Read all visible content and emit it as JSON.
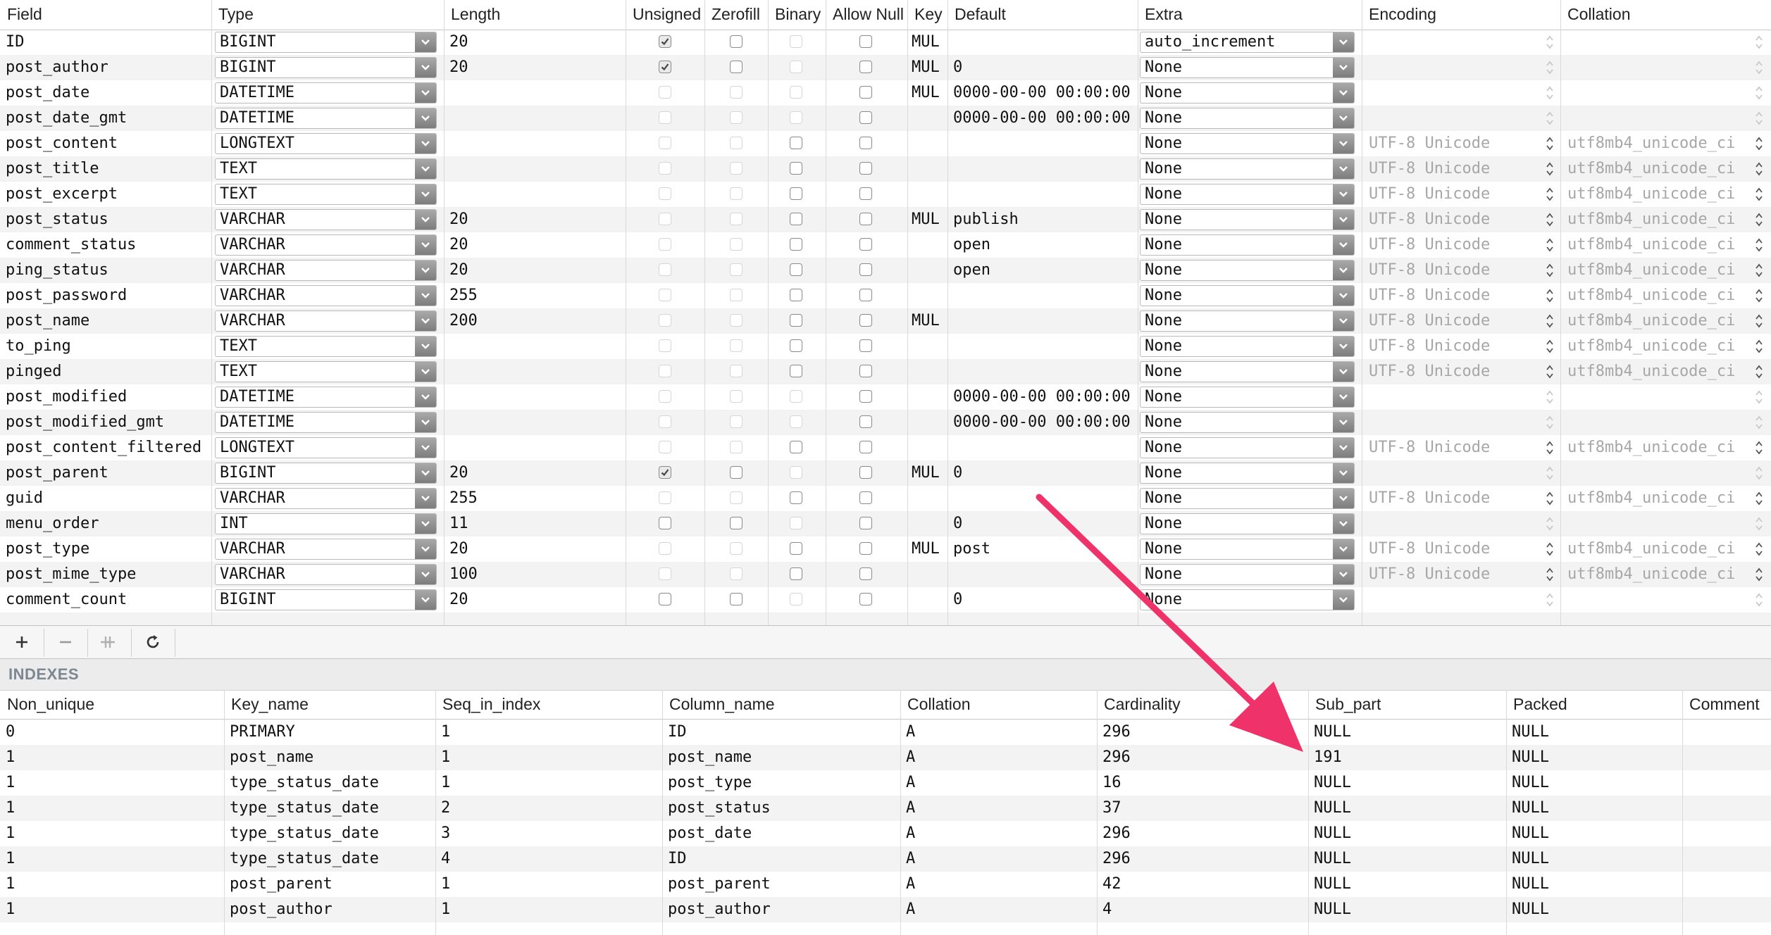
{
  "fields_table": {
    "columns": [
      "Field",
      "Type",
      "Length",
      "Unsigned",
      "Zerofill",
      "Binary",
      "Allow Null",
      "Key",
      "Default",
      "Extra",
      "Encoding",
      "Collation"
    ],
    "rows": [
      {
        "field": "ID",
        "type": "BIGINT",
        "length": "20",
        "unsigned": true,
        "zerofill": false,
        "binary": false,
        "allow_null": false,
        "key": "MUL",
        "default": "",
        "extra": "auto_increment",
        "encoding": "",
        "collation": ""
      },
      {
        "field": "post_author",
        "type": "BIGINT",
        "length": "20",
        "unsigned": true,
        "zerofill": false,
        "binary": false,
        "allow_null": false,
        "key": "MUL",
        "default": "0",
        "extra": "None",
        "encoding": "",
        "collation": ""
      },
      {
        "field": "post_date",
        "type": "DATETIME",
        "length": "",
        "unsigned": false,
        "zerofill": false,
        "binary": false,
        "allow_null": false,
        "key": "MUL",
        "default": "0000-00-00 00:00:00",
        "extra": "None",
        "encoding": "",
        "collation": ""
      },
      {
        "field": "post_date_gmt",
        "type": "DATETIME",
        "length": "",
        "unsigned": false,
        "zerofill": false,
        "binary": false,
        "allow_null": false,
        "key": "",
        "default": "0000-00-00 00:00:00",
        "extra": "None",
        "encoding": "",
        "collation": ""
      },
      {
        "field": "post_content",
        "type": "LONGTEXT",
        "length": "",
        "unsigned": false,
        "zerofill": false,
        "binary": false,
        "allow_null": false,
        "key": "",
        "default": "",
        "extra": "None",
        "encoding": "UTF-8 Unicode",
        "collation": "utf8mb4_unicode_ci"
      },
      {
        "field": "post_title",
        "type": "TEXT",
        "length": "",
        "unsigned": false,
        "zerofill": false,
        "binary": false,
        "allow_null": false,
        "key": "",
        "default": "",
        "extra": "None",
        "encoding": "UTF-8 Unicode",
        "collation": "utf8mb4_unicode_ci"
      },
      {
        "field": "post_excerpt",
        "type": "TEXT",
        "length": "",
        "unsigned": false,
        "zerofill": false,
        "binary": false,
        "allow_null": false,
        "key": "",
        "default": "",
        "extra": "None",
        "encoding": "UTF-8 Unicode",
        "collation": "utf8mb4_unicode_ci"
      },
      {
        "field": "post_status",
        "type": "VARCHAR",
        "length": "20",
        "unsigned": false,
        "zerofill": false,
        "binary": false,
        "allow_null": false,
        "key": "MUL",
        "default": "publish",
        "extra": "None",
        "encoding": "UTF-8 Unicode",
        "collation": "utf8mb4_unicode_ci"
      },
      {
        "field": "comment_status",
        "type": "VARCHAR",
        "length": "20",
        "unsigned": false,
        "zerofill": false,
        "binary": false,
        "allow_null": false,
        "key": "",
        "default": "open",
        "extra": "None",
        "encoding": "UTF-8 Unicode",
        "collation": "utf8mb4_unicode_ci"
      },
      {
        "field": "ping_status",
        "type": "VARCHAR",
        "length": "20",
        "unsigned": false,
        "zerofill": false,
        "binary": false,
        "allow_null": false,
        "key": "",
        "default": "open",
        "extra": "None",
        "encoding": "UTF-8 Unicode",
        "collation": "utf8mb4_unicode_ci"
      },
      {
        "field": "post_password",
        "type": "VARCHAR",
        "length": "255",
        "unsigned": false,
        "zerofill": false,
        "binary": false,
        "allow_null": false,
        "key": "",
        "default": "",
        "extra": "None",
        "encoding": "UTF-8 Unicode",
        "collation": "utf8mb4_unicode_ci"
      },
      {
        "field": "post_name",
        "type": "VARCHAR",
        "length": "200",
        "unsigned": false,
        "zerofill": false,
        "binary": false,
        "allow_null": false,
        "key": "MUL",
        "default": "",
        "extra": "None",
        "encoding": "UTF-8 Unicode",
        "collation": "utf8mb4_unicode_ci"
      },
      {
        "field": "to_ping",
        "type": "TEXT",
        "length": "",
        "unsigned": false,
        "zerofill": false,
        "binary": false,
        "allow_null": false,
        "key": "",
        "default": "",
        "extra": "None",
        "encoding": "UTF-8 Unicode",
        "collation": "utf8mb4_unicode_ci"
      },
      {
        "field": "pinged",
        "type": "TEXT",
        "length": "",
        "unsigned": false,
        "zerofill": false,
        "binary": false,
        "allow_null": false,
        "key": "",
        "default": "",
        "extra": "None",
        "encoding": "UTF-8 Unicode",
        "collation": "utf8mb4_unicode_ci"
      },
      {
        "field": "post_modified",
        "type": "DATETIME",
        "length": "",
        "unsigned": false,
        "zerofill": false,
        "binary": false,
        "allow_null": false,
        "key": "",
        "default": "0000-00-00 00:00:00",
        "extra": "None",
        "encoding": "",
        "collation": ""
      },
      {
        "field": "post_modified_gmt",
        "type": "DATETIME",
        "length": "",
        "unsigned": false,
        "zerofill": false,
        "binary": false,
        "allow_null": false,
        "key": "",
        "default": "0000-00-00 00:00:00",
        "extra": "None",
        "encoding": "",
        "collation": ""
      },
      {
        "field": "post_content_filtered",
        "type": "LONGTEXT",
        "length": "",
        "unsigned": false,
        "zerofill": false,
        "binary": false,
        "allow_null": false,
        "key": "",
        "default": "",
        "extra": "None",
        "encoding": "UTF-8 Unicode",
        "collation": "utf8mb4_unicode_ci"
      },
      {
        "field": "post_parent",
        "type": "BIGINT",
        "length": "20",
        "unsigned": true,
        "zerofill": false,
        "binary": false,
        "allow_null": false,
        "key": "MUL",
        "default": "0",
        "extra": "None",
        "encoding": "",
        "collation": ""
      },
      {
        "field": "guid",
        "type": "VARCHAR",
        "length": "255",
        "unsigned": false,
        "zerofill": false,
        "binary": false,
        "allow_null": false,
        "key": "",
        "default": "",
        "extra": "None",
        "encoding": "UTF-8 Unicode",
        "collation": "utf8mb4_unicode_ci"
      },
      {
        "field": "menu_order",
        "type": "INT",
        "length": "11",
        "unsigned": false,
        "zerofill": false,
        "binary": false,
        "allow_null": false,
        "key": "",
        "default": "0",
        "extra": "None",
        "encoding": "",
        "collation": ""
      },
      {
        "field": "post_type",
        "type": "VARCHAR",
        "length": "20",
        "unsigned": false,
        "zerofill": false,
        "binary": false,
        "allow_null": false,
        "key": "MUL",
        "default": "post",
        "extra": "None",
        "encoding": "UTF-8 Unicode",
        "collation": "utf8mb4_unicode_ci"
      },
      {
        "field": "post_mime_type",
        "type": "VARCHAR",
        "length": "100",
        "unsigned": false,
        "zerofill": false,
        "binary": false,
        "allow_null": false,
        "key": "",
        "default": "",
        "extra": "None",
        "encoding": "UTF-8 Unicode",
        "collation": "utf8mb4_unicode_ci"
      },
      {
        "field": "comment_count",
        "type": "BIGINT",
        "length": "20",
        "unsigned": false,
        "zerofill": false,
        "binary": false,
        "allow_null": false,
        "key": "",
        "default": "0",
        "extra": "None",
        "encoding": "",
        "collation": ""
      }
    ]
  },
  "toolbar": {
    "add_icon": "plus-icon",
    "remove_icon": "minus-icon",
    "duplicate_icon": "duplicate-icon",
    "refresh_icon": "refresh-icon"
  },
  "indexes": {
    "section_title": "INDEXES",
    "columns": [
      "Non_unique",
      "Key_name",
      "Seq_in_index",
      "Column_name",
      "Collation",
      "Cardinality",
      "Sub_part",
      "Packed",
      "Comment"
    ],
    "rows": [
      [
        "0",
        "PRIMARY",
        "1",
        "ID",
        "A",
        "296",
        "NULL",
        "NULL",
        ""
      ],
      [
        "1",
        "post_name",
        "1",
        "post_name",
        "A",
        "296",
        "191",
        "NULL",
        ""
      ],
      [
        "1",
        "type_status_date",
        "1",
        "post_type",
        "A",
        "16",
        "NULL",
        "NULL",
        ""
      ],
      [
        "1",
        "type_status_date",
        "2",
        "post_status",
        "A",
        "37",
        "NULL",
        "NULL",
        ""
      ],
      [
        "1",
        "type_status_date",
        "3",
        "post_date",
        "A",
        "296",
        "NULL",
        "NULL",
        ""
      ],
      [
        "1",
        "type_status_date",
        "4",
        "ID",
        "A",
        "296",
        "NULL",
        "NULL",
        ""
      ],
      [
        "1",
        "post_parent",
        "1",
        "post_parent",
        "A",
        "42",
        "NULL",
        "NULL",
        ""
      ],
      [
        "1",
        "post_author",
        "1",
        "post_author",
        "A",
        "4",
        "NULL",
        "NULL",
        ""
      ]
    ]
  },
  "colors": {
    "annotation_arrow": "#f0326b",
    "stripe": "#f3f3f3",
    "section_bg": "#ececec",
    "section_title": "#7c8792",
    "disabled_text": "#a7a7a7"
  }
}
